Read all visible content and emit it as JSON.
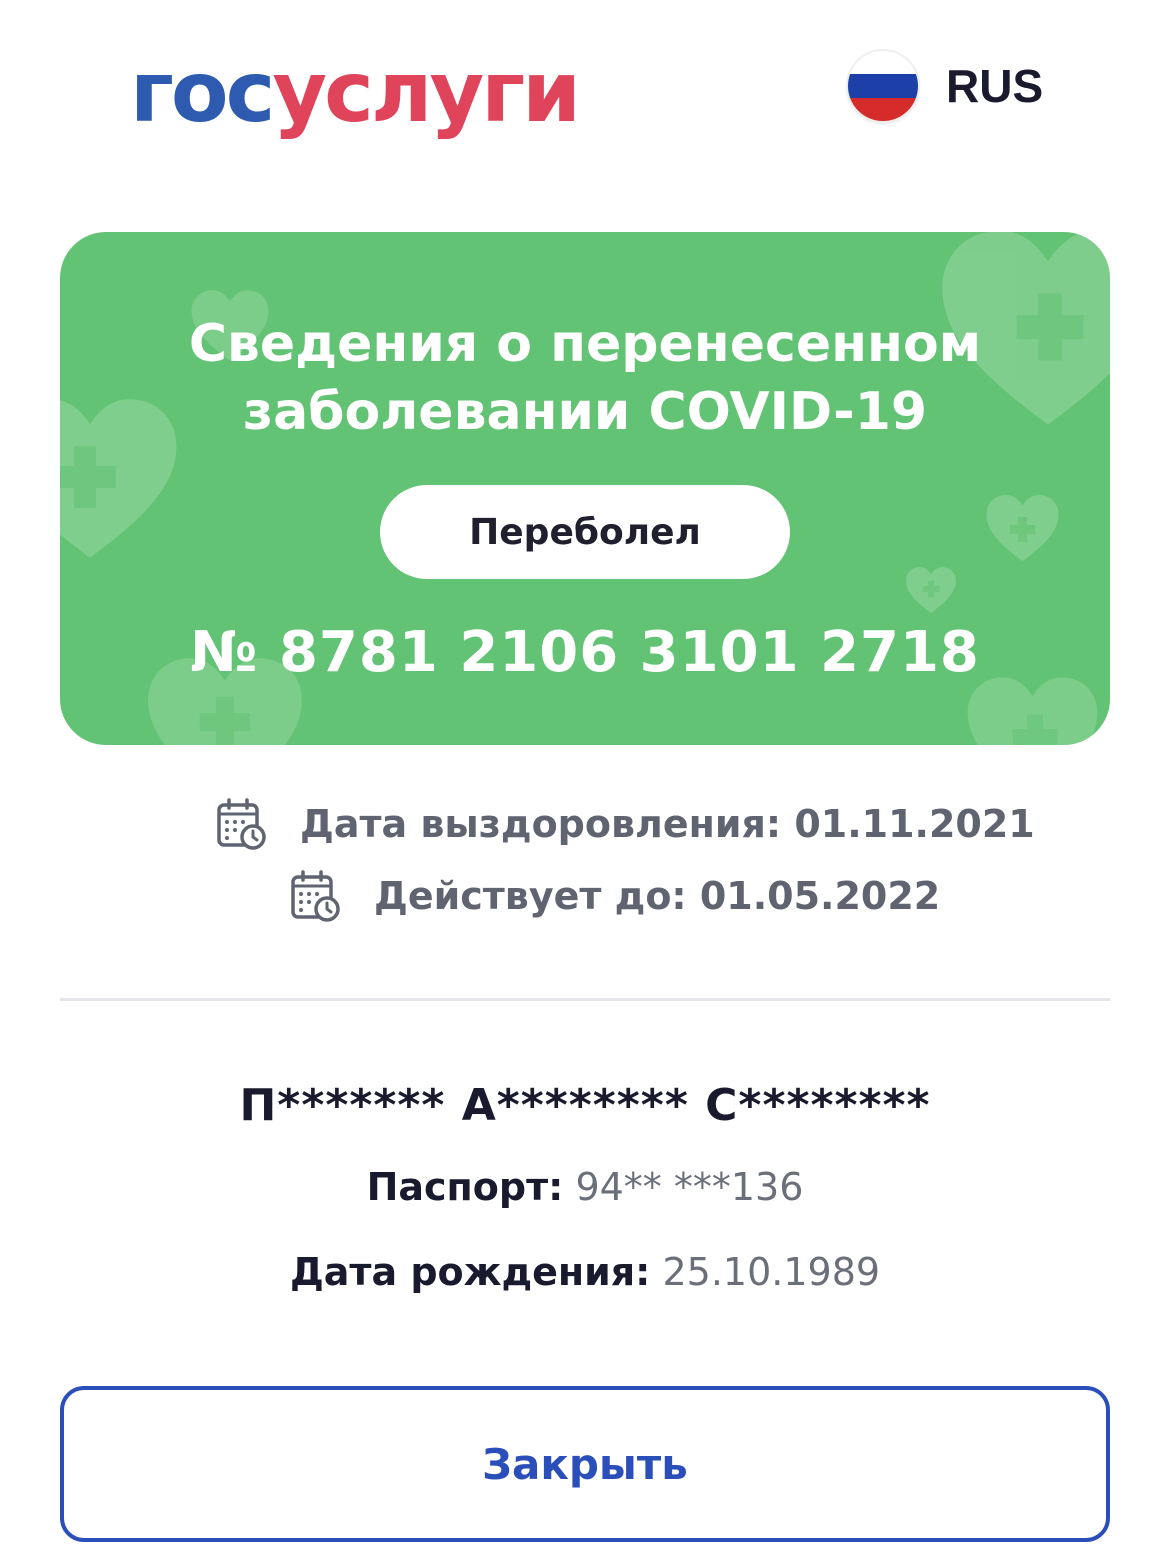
{
  "header": {
    "logo_part1": "гос",
    "logo_part2": "услуги",
    "language": "RUS",
    "flag_colors": [
      "#ffffff",
      "#1c3fa8",
      "#d52b2b"
    ]
  },
  "card": {
    "title": "Сведения о перенесенном\nзаболевании COVID-19",
    "status": "Переболел",
    "number": "№ 8781 2106 3101 2718",
    "background_color": "#63c374"
  },
  "dates": {
    "recovery_label": "Дата выздоровления: 01.11.2021",
    "valid_until_label": "Действует до: 01.05.2022",
    "icon": "calendar-clock-icon"
  },
  "person": {
    "name": "П******* А******** С********",
    "passport_label": "Паспорт:",
    "passport_value": "94** ***136",
    "birth_label": "Дата рождения:",
    "birth_value": "25.10.1989"
  },
  "actions": {
    "close_label": "Закрыть",
    "accent_color": "#2a4fba"
  }
}
